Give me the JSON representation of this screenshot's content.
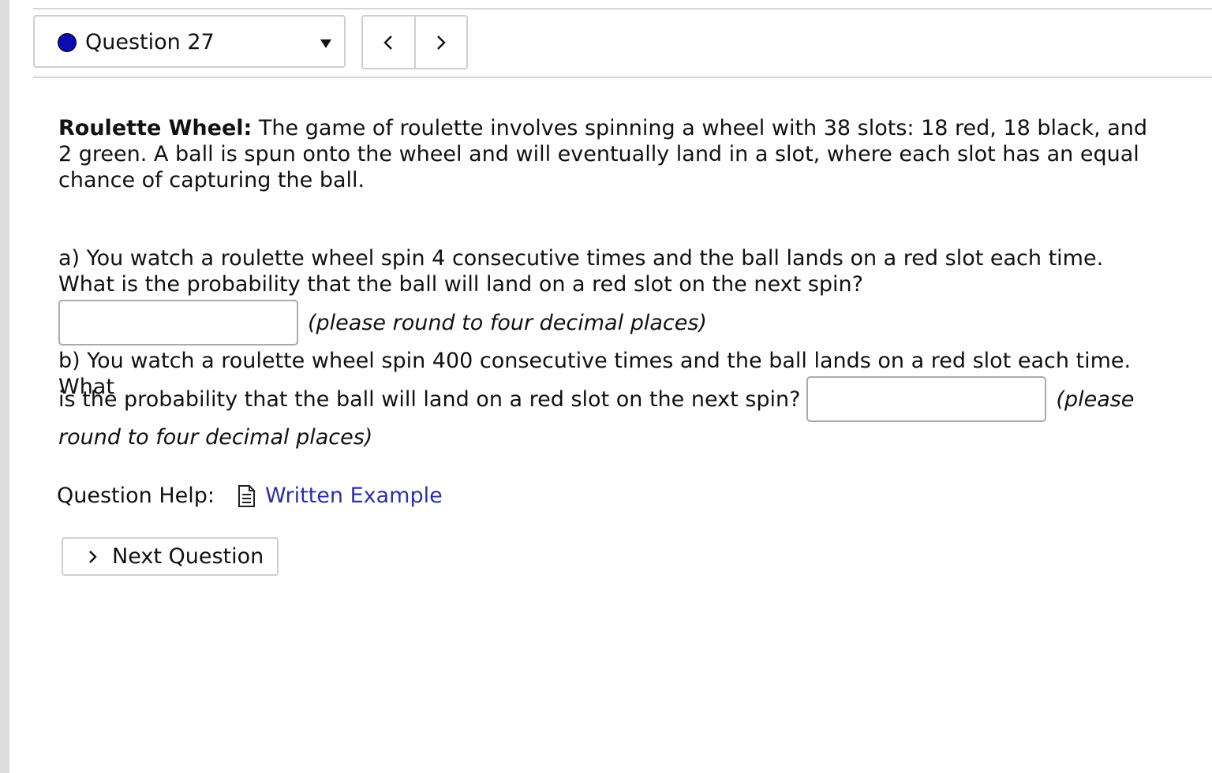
{
  "header": {
    "question_selector": {
      "label": "Question 27",
      "status_color": "#0b0bb3"
    },
    "nav": {
      "prev_icon": "chevron-left-icon",
      "next_icon": "chevron-right-icon"
    }
  },
  "problem": {
    "intro_title": "Roulette Wheel:",
    "intro_text": " The game of roulette involves spinning a wheel with 38 slots: 18 red, 18 black, and 2 green. A ball is spun onto the wheel and will eventually land in a slot, where each slot has an equal chance of capturing the ball.",
    "part_a": {
      "question": "a) You watch a roulette wheel spin 4 consecutive times and the ball lands on a red slot each time. What is the probability that the ball will land on a red slot on the next spin?",
      "answer_value": "",
      "hint": "(please round to four decimal places)"
    },
    "part_b": {
      "question_line1": "b) You watch a roulette wheel spin 400 consecutive times and the ball lands on a red slot each time. What",
      "question_line2": "is the probability that the ball will land on a red slot on the next spin?",
      "answer_value": "",
      "hint_part1": "(please",
      "hint_part2": "round to four decimal places)"
    }
  },
  "help": {
    "label": "Question Help:",
    "link_icon": "document-icon",
    "link_text": "Written Example"
  },
  "footer": {
    "next_button_label": "Next Question",
    "next_button_icon": "chevron-right-icon"
  }
}
